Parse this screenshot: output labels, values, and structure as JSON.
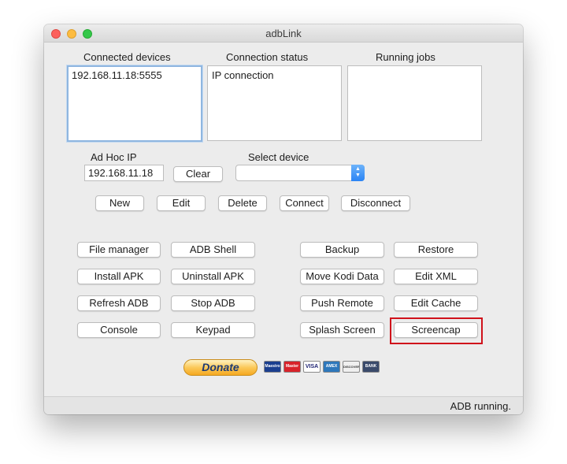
{
  "window": {
    "title": "adbLink"
  },
  "devices": {
    "connected_label": "Connected devices",
    "connected_items": [
      "192.168.11.18:5555"
    ],
    "status_label": "Connection status",
    "status_items": [
      "IP connection"
    ],
    "jobs_label": "Running jobs"
  },
  "adhoc": {
    "label": "Ad Hoc IP",
    "value": "192.168.11.18",
    "clear_label": "Clear",
    "select_label": "Select device",
    "select_value": ""
  },
  "device_actions": {
    "new": "New",
    "edit": "Edit",
    "delete": "Delete",
    "connect": "Connect",
    "disconnect": "Disconnect"
  },
  "tools": {
    "file_manager": "File manager",
    "adb_shell": "ADB Shell",
    "install_apk": "Install APK",
    "uninstall_apk": "Uninstall APK",
    "refresh_adb": "Refresh ADB",
    "stop_adb": "Stop ADB",
    "console": "Console",
    "keypad": "Keypad",
    "backup": "Backup",
    "restore": "Restore",
    "move_kodi_data": "Move Kodi Data",
    "edit_xml": "Edit XML",
    "push_remote": "Push Remote",
    "edit_cache": "Edit Cache",
    "splash_screen": "Splash Screen",
    "screencap": "Screencap"
  },
  "donate": {
    "label": "Donate",
    "cards": [
      "Maestro",
      "Master",
      "VISA",
      "AMEX",
      "DISCOVER",
      "BANK"
    ]
  },
  "statusbar": {
    "text": "ADB running."
  },
  "colors": {
    "highlight": "#d0121b",
    "window_bg": "#ececec",
    "focus_ring": "#8fb6e0"
  }
}
